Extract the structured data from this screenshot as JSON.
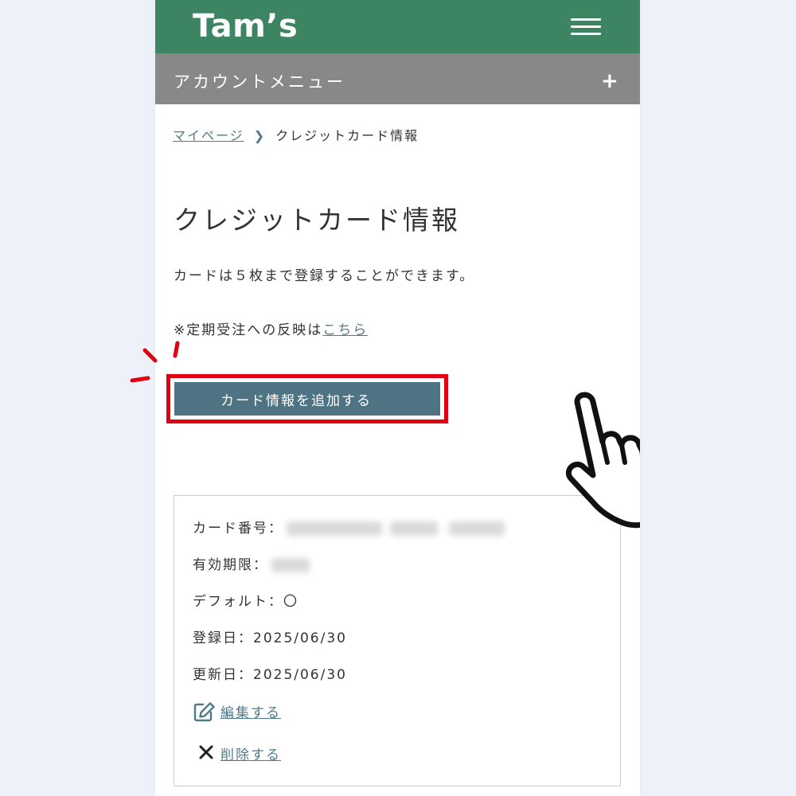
{
  "header": {
    "logo": "Tam’s",
    "menu_icon": "hamburger-icon"
  },
  "account_menu": {
    "label": "アカウントメニュー",
    "expand_glyph": "+"
  },
  "breadcrumb": {
    "home": "マイページ",
    "separator": "❯",
    "current": "クレジットカード情報"
  },
  "page": {
    "title": "クレジットカード情報",
    "description": "カードは５枚まで登録することができます。",
    "note_prefix": "※定期受注への反映は",
    "note_link": "こちら",
    "add_button": "カード情報を追加する"
  },
  "card": {
    "number_label": "カード番号：",
    "expiry_label": "有効期限：",
    "default_label": "デフォルト：",
    "default_value": "〇",
    "registered_label": "登録日：",
    "registered_value": "2025/06/30",
    "updated_label": "更新日：",
    "updated_value": "2025/06/30",
    "edit_label": "編集する",
    "delete_label": "削除する"
  },
  "colors": {
    "header_bg": "#3c8462",
    "account_bar_bg": "#888888",
    "button_bg": "#4e7383",
    "highlight_red": "#e00012",
    "link": "#4f7a8a"
  },
  "icons": [
    "hamburger-icon",
    "plus-icon",
    "chevron-right-icon",
    "edit-icon",
    "close-icon",
    "pointing-hand-icon"
  ]
}
